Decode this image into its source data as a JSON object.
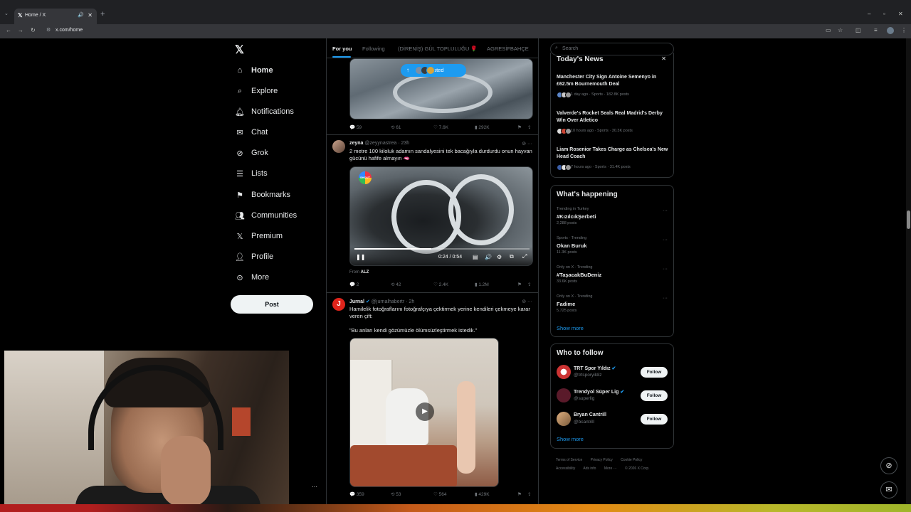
{
  "browser": {
    "tab_title": "Home / X",
    "url": "x.com/home"
  },
  "nav": {
    "items": [
      {
        "label": "Home",
        "icon": "home-icon"
      },
      {
        "label": "Explore",
        "icon": "search-icon"
      },
      {
        "label": "Notifications",
        "icon": "bell-icon"
      },
      {
        "label": "Chat",
        "icon": "mail-icon"
      },
      {
        "label": "Grok",
        "icon": "grok-icon"
      },
      {
        "label": "Lists",
        "icon": "list-icon"
      },
      {
        "label": "Bookmarks",
        "icon": "bookmark-icon"
      },
      {
        "label": "Communities",
        "icon": "people-icon"
      },
      {
        "label": "Premium",
        "icon": "x-icon"
      },
      {
        "label": "Profile",
        "icon": "person-icon"
      },
      {
        "label": "More",
        "icon": "more-circle-icon"
      }
    ],
    "post_label": "Post",
    "more_dots": "···"
  },
  "feed": {
    "tabs": [
      "For you",
      "Following",
      "(DİRENİŞ) GÜL TOPLULUĞU 🌹",
      "AGRESİFBAHÇE"
    ],
    "posted_pill": "posted",
    "tweet0_actions": {
      "replies": "59",
      "reposts": "61",
      "likes": "7.6K",
      "views": "292K"
    },
    "tweet1": {
      "name": "zeyna",
      "handle": "@zeyynastrea · 23h",
      "text": "2 metre 100 kiloluk adamın sandalyesini tek bacağıyla durdurdu onun hayvan gücünü hafife almayın 🫦",
      "video_time": "0:24 / 0:54",
      "video_progress": 0.44,
      "from_prefix": "From",
      "from_source": "ALZ",
      "shout_logo": "SHOUT",
      "actions": {
        "replies": "2",
        "reposts": "42",
        "likes": "2.4K",
        "views": "1.2M"
      }
    },
    "tweet2": {
      "name": "Jurnal",
      "handle": "@jurnalhabertr · 2h",
      "text": "Hamilelik fotoğraflarını fotoğrafçıya çektirmek yerine kendileri çekmeye karar veren çift:",
      "quote": "\"Bu anları kendi gözümüzle ölümsüzleştirmek istedik.\"",
      "avatar_letter": "J",
      "actions": {
        "replies": "359",
        "reposts": "53",
        "likes": "564",
        "views": "429K"
      }
    }
  },
  "search": {
    "placeholder": "Search"
  },
  "news": {
    "title": "Today's News",
    "items": [
      {
        "title": "Manchester City Sign Antoine Semenyo in £62.5m Bournemouth Deal",
        "meta": "1 day ago · Sports · 182.8K posts"
      },
      {
        "title": "Valverde's Rocket Seals Real Madrid's Derby Win Over Atletico",
        "meta": "10 hours ago · Sports · 30.3K posts"
      },
      {
        "title": "Liam Rosenior Takes Charge as Chelsea's New Head Coach",
        "meta": "7 hours ago · Sports · 31.4K posts"
      }
    ]
  },
  "trends": {
    "title": "What's happening",
    "items": [
      {
        "context": "Trending in Turkey",
        "name": "#KızılcıkŞerbeti",
        "count": "2,288 posts"
      },
      {
        "context": "Sports · Trending",
        "name": "Okan Buruk",
        "count": "11.3K posts"
      },
      {
        "context": "Only on X · Trending",
        "name": "#TaşacakBuDeniz",
        "count": "33.6K posts"
      },
      {
        "context": "Only on X · Trending",
        "name": "Fadime",
        "count": "5,725 posts"
      }
    ],
    "show_more": "Show more"
  },
  "who_to_follow": {
    "title": "Who to follow",
    "items": [
      {
        "name": "TRT Spor Yıldız",
        "handle": "@trtsporyildiz"
      },
      {
        "name": "Trendyol Süper Lig",
        "handle": "@superlig"
      },
      {
        "name": "Bryan Cantrill",
        "handle": "@bcantrill"
      }
    ],
    "follow_label": "Follow",
    "show_more": "Show more"
  },
  "footer": {
    "links": [
      "Terms of Service",
      "Privacy Policy",
      "Cookie Policy",
      "Accessibility",
      "Ads info",
      "More ···",
      "© 2026 X Corp."
    ]
  },
  "colors": {
    "accent": "#1d9bf0",
    "background": "#000000",
    "border": "#2f3336"
  }
}
